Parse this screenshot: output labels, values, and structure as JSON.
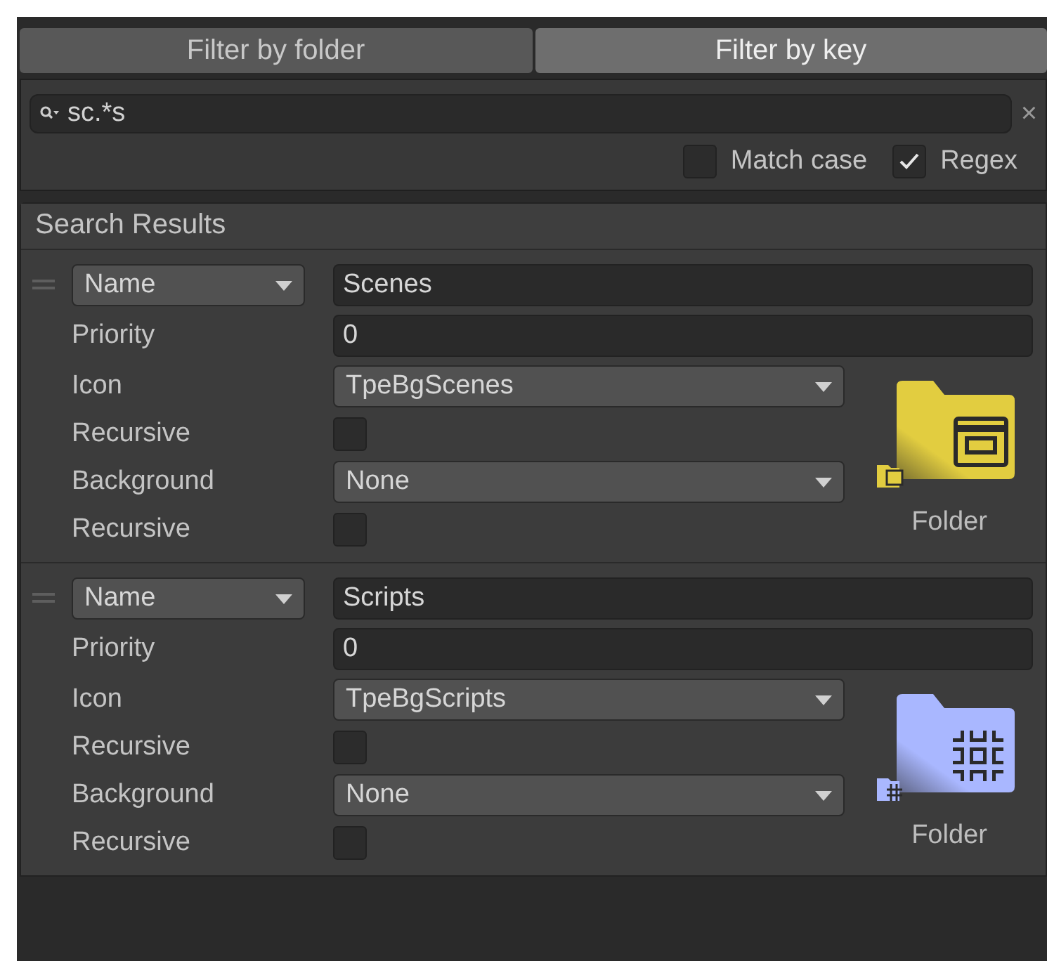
{
  "tabs": [
    {
      "label": "Filter by folder",
      "selected": false
    },
    {
      "label": "Filter by key",
      "selected": true
    }
  ],
  "search": {
    "value": "sc.*s",
    "clear": "×"
  },
  "options": [
    {
      "label": "Match case",
      "checked": false
    },
    {
      "label": "Regex",
      "checked": true
    }
  ],
  "results": {
    "title": "Search Results",
    "items": [
      {
        "key_type": "Name",
        "value": "Scenes",
        "priority_label": "Priority",
        "priority": "0",
        "icon_label": "Icon",
        "icon": "TpeBgScenes",
        "icon_recursive_label": "Recursive",
        "icon_recursive": false,
        "background_label": "Background",
        "background": "None",
        "background_recursive_label": "Recursive",
        "background_recursive": false,
        "preview_label": "Folder",
        "kind": "scenes",
        "color": "#e2cd40"
      },
      {
        "key_type": "Name",
        "value": "Scripts",
        "priority_label": "Priority",
        "priority": "0",
        "icon_label": "Icon",
        "icon": "TpeBgScripts",
        "icon_recursive_label": "Recursive",
        "icon_recursive": false,
        "background_label": "Background",
        "background": "None",
        "background_recursive_label": "Recursive",
        "background_recursive": false,
        "preview_label": "Folder",
        "kind": "scripts",
        "color": "#a9b7ff"
      }
    ]
  }
}
